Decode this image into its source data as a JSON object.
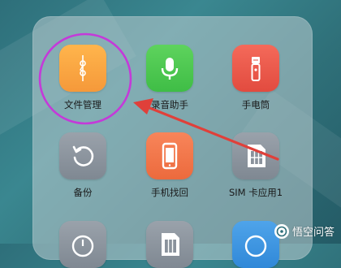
{
  "apps": [
    {
      "label": "文件管理",
      "icon": "folder-document-icon",
      "color": "#F5A23F"
    },
    {
      "label": "录音助手",
      "icon": "microphone-icon",
      "color": "#4CC552"
    },
    {
      "label": "手电筒",
      "icon": "flashlight-icon",
      "color": "#EA5444"
    },
    {
      "label": "备份",
      "icon": "backup-refresh-icon",
      "color": "#8A929C"
    },
    {
      "label": "手机找回",
      "icon": "phone-find-icon",
      "color": "#F2784A"
    },
    {
      "label": "SIM 卡应用1",
      "icon": "sim-card-icon",
      "color": "#8A929C"
    },
    {
      "label": "",
      "icon": "clock-icon",
      "color": "#8A929C"
    },
    {
      "label": "",
      "icon": "sim-card-icon",
      "color": "#8A929C"
    },
    {
      "label": "",
      "icon": "browser-icon",
      "color": "#3C93DF"
    }
  ],
  "annotation": {
    "highlight_color": "#C43AD9",
    "arrow_color": "#E0403A"
  },
  "watermark": {
    "text": "悟空问答",
    "icon": "wukong-logo-icon"
  }
}
